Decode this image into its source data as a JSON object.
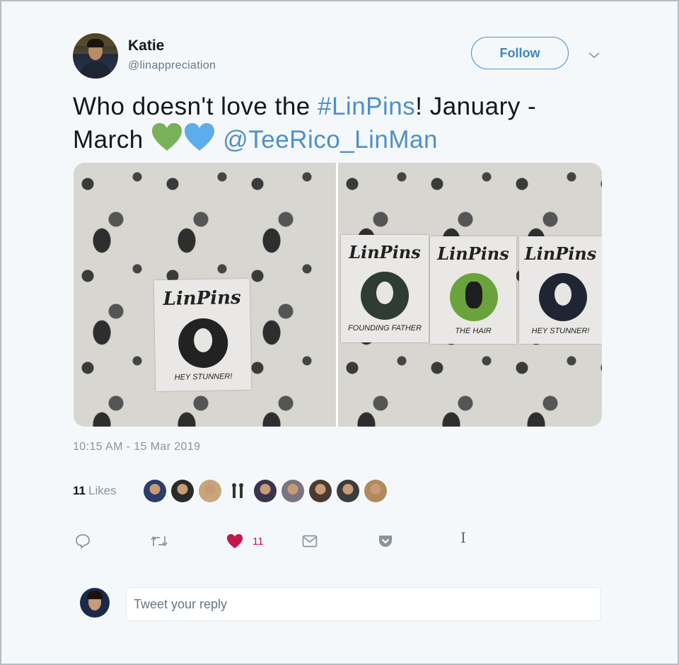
{
  "author": {
    "name": "Katie",
    "handle": "@linappreciation",
    "follow_label": "Follow"
  },
  "tweet": {
    "text_part1": "Who doesn't love the ",
    "hashtag": "#LinPins",
    "text_part2": "! January -",
    "text_part3": "March",
    "emoji": [
      "green-heart",
      "blue-heart"
    ],
    "mention": "@TeeRico_LinMan",
    "timestamp": "10:15 AM - 15 Mar 2019"
  },
  "media": {
    "left_pin": {
      "logo": "LinPins",
      "caption": "HEY STUNNER!"
    },
    "right_pins": [
      {
        "logo": "LinPins",
        "caption": "FOUNDING FATHER",
        "color": "#2f3c35"
      },
      {
        "logo": "LinPins",
        "caption": "THE HAIR",
        "color": "#6aa33b"
      },
      {
        "logo": "LinPins",
        "caption": "HEY STUNNER!",
        "color": "#1f2533"
      }
    ]
  },
  "engagement": {
    "likes_count": "11",
    "likes_label": "Likes",
    "heart_count": "11",
    "liker_colors": [
      "#2b3d6b",
      "#2a2a2a",
      "#c9a57a",
      "#f5f8fa",
      "#3a3450",
      "#7a7580",
      "#4a3a30",
      "#3c3c3c",
      "#b08a5a"
    ]
  },
  "actions": {
    "reply_icon": "reply-icon",
    "retweet_icon": "retweet-icon",
    "like_icon": "heart-icon",
    "dm_icon": "envelope-icon",
    "pocket_icon": "pocket-icon"
  },
  "reply": {
    "placeholder": "Tweet your reply"
  },
  "colors": {
    "link": "#4d8fcd",
    "like": "#c4174c",
    "follow_border": "#4a90d9"
  }
}
